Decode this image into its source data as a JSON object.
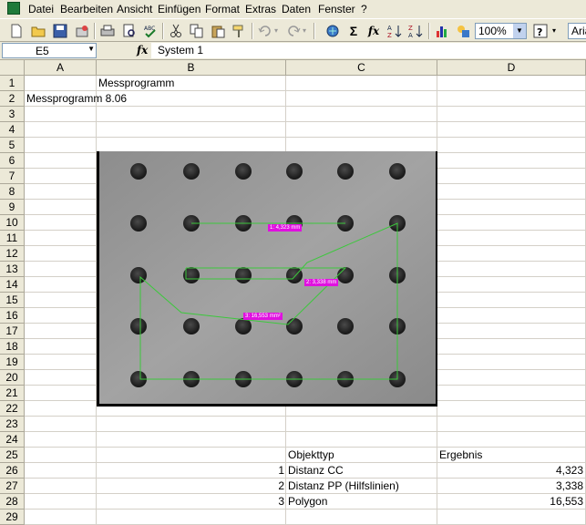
{
  "menu": [
    "Datei",
    "Bearbeiten",
    "Ansicht",
    "Einfügen",
    "Format",
    "Extras",
    "Daten",
    "Fenster",
    "?"
  ],
  "toolbar": {
    "zoom": "100%",
    "font_partial": "Aria"
  },
  "formula_bar": {
    "name_box": "E5",
    "fx_label": "fx",
    "content": "System 1"
  },
  "columns": [
    "A",
    "B",
    "C",
    "D"
  ],
  "rows": [
    "1",
    "2",
    "3",
    "4",
    "5",
    "6",
    "7",
    "8",
    "9",
    "10",
    "11",
    "12",
    "13",
    "14",
    "15",
    "16",
    "17",
    "18",
    "19",
    "20",
    "21",
    "22",
    "23",
    "24",
    "25",
    "26",
    "27",
    "28",
    "29"
  ],
  "cells": {
    "b1": "Messprogramm",
    "a2": "Messprogramm 8.06",
    "c25": "Objekttyp",
    "d25": "Ergebnis",
    "results": [
      {
        "nr": "1",
        "type": "Distanz CC",
        "value": "4,323"
      },
      {
        "nr": "2",
        "type": "Distanz PP (Hilfslinien)",
        "value": "3,338"
      },
      {
        "nr": "3",
        "type": "Polygon",
        "value": "16,553"
      }
    ]
  },
  "picture_labels": [
    "1: 4,323 mm",
    "2: 3,338 mm",
    "3: 16,553 mm²"
  ],
  "colors": {
    "chrome": "#ece9d8",
    "label_magenta": "#e010e0",
    "measure_line": "#3cc83c",
    "plate": "#9a9a9a"
  }
}
